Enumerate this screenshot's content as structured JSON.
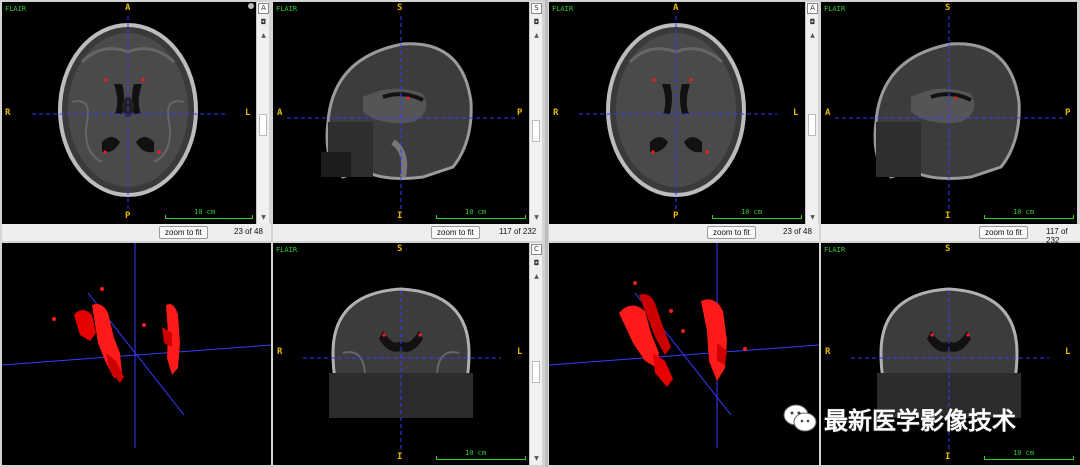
{
  "modality": "FLAIR",
  "scale_label": "10 cm",
  "zoom_label": "zoom to fit",
  "orient": {
    "axial": {
      "top": "A",
      "bottom": "P",
      "left": "R",
      "right": "L"
    },
    "sagittal": {
      "top": "S",
      "bottom": "I",
      "left": "A",
      "right": "P"
    },
    "coronal": {
      "top": "S",
      "bottom": "I",
      "left": "R",
      "right": "L"
    }
  },
  "strip_buttons": {
    "axial": "A",
    "sagittal": "S",
    "coronal": "C"
  },
  "left": {
    "axial_slice": "23 of 48",
    "sagittal_slice": "117 of 232"
  },
  "right": {
    "axial_slice": "23 of 48",
    "sagittal_slice": "117 of 232"
  },
  "watermark": "最新医学影像技术",
  "colors": {
    "crosshair": "#3a3aff",
    "lesion": "#ff1a1a",
    "label": "#e8b800",
    "modality": "#2ecc2e"
  }
}
